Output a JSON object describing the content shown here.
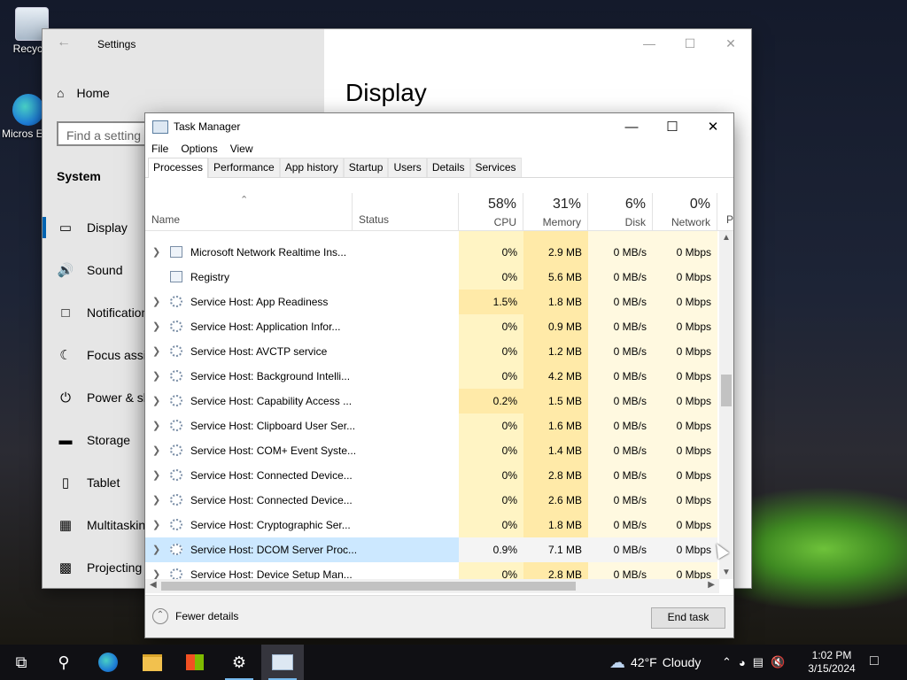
{
  "desktop": {
    "icons": [
      {
        "label": "Recycle",
        "icon": "recycle-bin-icon"
      },
      {
        "label": "Micros Edg",
        "icon": "edge-icon"
      }
    ]
  },
  "settings": {
    "title": "Settings",
    "home": "Home",
    "search_placeholder": "Find a setting",
    "section": "System",
    "page_title": "Display",
    "nav": [
      {
        "label": "Display",
        "icon": "monitor-icon"
      },
      {
        "label": "Sound",
        "icon": "speaker-icon"
      },
      {
        "label": "Notification",
        "icon": "notification-icon"
      },
      {
        "label": "Focus assist",
        "icon": "moon-icon"
      },
      {
        "label": "Power & sle",
        "icon": "power-icon"
      },
      {
        "label": "Storage",
        "icon": "storage-icon"
      },
      {
        "label": "Tablet",
        "icon": "tablet-icon"
      },
      {
        "label": "Multitasking",
        "icon": "multitasking-icon"
      },
      {
        "label": "Projecting t",
        "icon": "projecting-icon"
      }
    ]
  },
  "taskmanager": {
    "title": "Task Manager",
    "menu": [
      "File",
      "Options",
      "View"
    ],
    "tabs": [
      "Processes",
      "Performance",
      "App history",
      "Startup",
      "Users",
      "Details",
      "Services"
    ],
    "active_tab": "Processes",
    "columns": {
      "name": "Name",
      "status": "Status",
      "cpu": {
        "pct": "58%",
        "label": "CPU"
      },
      "memory": {
        "pct": "31%",
        "label": "Memory"
      },
      "disk": {
        "pct": "6%",
        "label": "Disk"
      },
      "network": {
        "pct": "0%",
        "label": "Network"
      },
      "power": "P"
    },
    "rows": [
      {
        "name": "Microsoft Network Realtime Ins...",
        "expandable": true,
        "icon": "window-icon",
        "cpu": "0%",
        "mem": "2.9 MB",
        "disk": "0 MB/s",
        "net": "0 Mbps"
      },
      {
        "name": "Registry",
        "expandable": false,
        "icon": "window-icon",
        "cpu": "0%",
        "mem": "5.6 MB",
        "disk": "0 MB/s",
        "net": "0 Mbps"
      },
      {
        "name": "Service Host: App Readiness",
        "expandable": true,
        "icon": "gear-icon",
        "cpu": "1.5%",
        "mem": "1.8 MB",
        "disk": "0 MB/s",
        "net": "0 Mbps"
      },
      {
        "name": "Service Host: Application Infor...",
        "expandable": true,
        "icon": "gear-icon",
        "cpu": "0%",
        "mem": "0.9 MB",
        "disk": "0 MB/s",
        "net": "0 Mbps"
      },
      {
        "name": "Service Host: AVCTP service",
        "expandable": true,
        "icon": "gear-icon",
        "cpu": "0%",
        "mem": "1.2 MB",
        "disk": "0 MB/s",
        "net": "0 Mbps"
      },
      {
        "name": "Service Host: Background Intelli...",
        "expandable": true,
        "icon": "gear-icon",
        "cpu": "0%",
        "mem": "4.2 MB",
        "disk": "0 MB/s",
        "net": "0 Mbps"
      },
      {
        "name": "Service Host: Capability Access ...",
        "expandable": true,
        "icon": "gear-icon",
        "cpu": "0.2%",
        "mem": "1.5 MB",
        "disk": "0 MB/s",
        "net": "0 Mbps"
      },
      {
        "name": "Service Host: Clipboard User Ser...",
        "expandable": true,
        "icon": "gear-icon",
        "cpu": "0%",
        "mem": "1.6 MB",
        "disk": "0 MB/s",
        "net": "0 Mbps"
      },
      {
        "name": "Service Host: COM+ Event Syste...",
        "expandable": true,
        "icon": "gear-icon",
        "cpu": "0%",
        "mem": "1.4 MB",
        "disk": "0 MB/s",
        "net": "0 Mbps"
      },
      {
        "name": "Service Host: Connected Device...",
        "expandable": true,
        "icon": "gear-icon",
        "cpu": "0%",
        "mem": "2.8 MB",
        "disk": "0 MB/s",
        "net": "0 Mbps"
      },
      {
        "name": "Service Host: Connected Device...",
        "expandable": true,
        "icon": "gear-icon",
        "cpu": "0%",
        "mem": "2.6 MB",
        "disk": "0 MB/s",
        "net": "0 Mbps"
      },
      {
        "name": "Service Host: Cryptographic Ser...",
        "expandable": true,
        "icon": "gear-icon",
        "cpu": "0%",
        "mem": "1.8 MB",
        "disk": "0 MB/s",
        "net": "0 Mbps"
      },
      {
        "name": "Service Host: DCOM Server Proc...",
        "expandable": true,
        "icon": "gear-icon",
        "cpu": "0.9%",
        "mem": "7.1 MB",
        "disk": "0 MB/s",
        "net": "0 Mbps",
        "selected": true
      },
      {
        "name": "Service Host: Device Setup Man...",
        "expandable": true,
        "icon": "gear-icon",
        "cpu": "0%",
        "mem": "2.8 MB",
        "disk": "0 MB/s",
        "net": "0 Mbps"
      }
    ],
    "fewer_details": "Fewer details",
    "end_task": "End task"
  },
  "taskbar": {
    "weather": {
      "temp": "42°F",
      "condition": "Cloudy"
    },
    "time": "1:02 PM",
    "date": "3/15/2024"
  },
  "colors": {
    "cpu_heat": "#fff4c4",
    "mem_heat": "#ffeaa8",
    "low_heat": "#fff9e0",
    "selected": "#cce8ff",
    "accent": "#0063b1"
  }
}
